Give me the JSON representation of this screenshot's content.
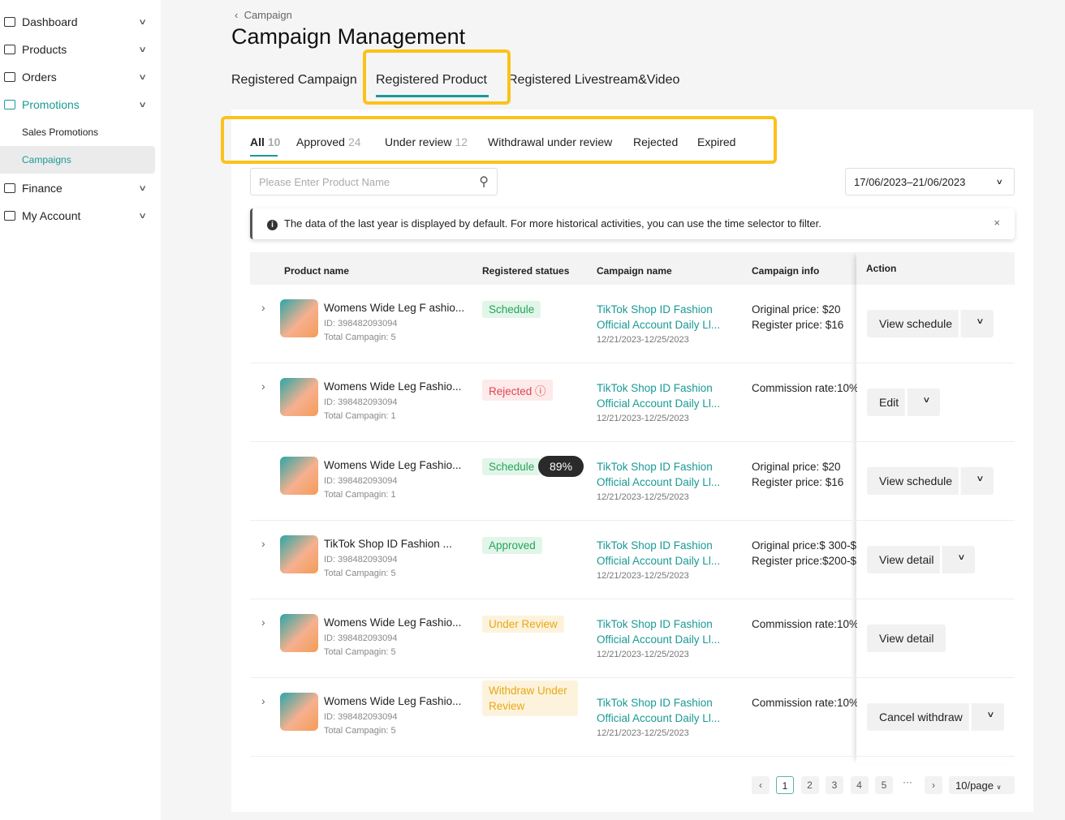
{
  "sidebar": {
    "items": [
      {
        "label": "Dashboard",
        "icon": "dashboard-icon"
      },
      {
        "label": "Products",
        "icon": "products-icon"
      },
      {
        "label": "Orders",
        "icon": "orders-icon"
      },
      {
        "label": "Promotions",
        "icon": "megaphone-icon"
      },
      {
        "label": "Sales Promotions"
      },
      {
        "label": "Campaigns"
      },
      {
        "label": "Finance",
        "icon": "finance-icon"
      },
      {
        "label": "My Account",
        "icon": "user-icon"
      }
    ]
  },
  "breadcrumb": "Campaign",
  "title": "Campaign Management",
  "tabs": [
    "Registered Campaign",
    "Registered Product",
    "Registered Livestream&Video"
  ],
  "status_tabs": [
    {
      "label": "All",
      "count": "10"
    },
    {
      "label": "Approved",
      "count": "24"
    },
    {
      "label": "Under review",
      "count": "12"
    },
    {
      "label": "Withdrawal under review"
    },
    {
      "label": "Rejected"
    },
    {
      "label": "Expired"
    }
  ],
  "search_placeholder": "Please Enter Product Name",
  "date_range": "17/06/2023–21/06/2023",
  "alert": "The data of the last year is displayed by default. For more historical activities, you can use the time selector to filter.",
  "columns": [
    "Product name",
    "Registered statues",
    "Campaign name",
    "Campaign info",
    "Action"
  ],
  "rows": [
    {
      "name": "Womens Wide Leg F ashio...",
      "id": "ID: 398482093094",
      "total": "Total Campagin: 5",
      "status": "Schedule",
      "tone": "green",
      "campaign": "TikTok Shop ID Fashion Official Account Daily Ll...",
      "dates": "12/21/2023-12/25/2023",
      "info": [
        "Original price:  $20",
        "Register price: $16"
      ],
      "action": "View schedule",
      "dropdown": true,
      "expand": true
    },
    {
      "name": "Womens Wide Leg Fashio...",
      "id": "ID: 398482093094",
      "total": "Total Campagin: 1",
      "status": "Rejected ⓘ",
      "tone": "red",
      "campaign": "TikTok Shop ID Fashion Official Account Daily Ll...",
      "dates": "12/21/2023-12/25/2023",
      "info": [
        "Commission rate:10%"
      ],
      "action": "Edit",
      "dropdown": true,
      "expand": true
    },
    {
      "name": "Womens Wide Leg Fashio...",
      "id": "ID: 398482093094",
      "total": "Total Campagin: 1",
      "status": "Schedule",
      "tone": "green",
      "progress": "89%",
      "campaign": "TikTok Shop ID Fashion Official Account Daily Ll...",
      "dates": "12/21/2023-12/25/2023",
      "info": [
        "Original price:  $20",
        "Register price: $16"
      ],
      "action": "View schedule",
      "dropdown": true,
      "expand": false
    },
    {
      "name": "TikTok Shop ID Fashion ...",
      "id": "ID: 398482093094",
      "total": "Total Campagin: 5",
      "status": "Approved",
      "tone": "green",
      "campaign": "TikTok Shop ID Fashion Official Account Daily Ll...",
      "dates": "12/21/2023-12/25/2023",
      "info": [
        "Original price:$ 300-$",
        "Register price:$200-$"
      ],
      "action": "View detail",
      "dropdown": true,
      "expand": true
    },
    {
      "name": "Womens Wide Leg Fashio...",
      "id": "ID: 398482093094",
      "total": "Total Campagin: 5",
      "status": "Under Review",
      "tone": "yellow",
      "campaign": "TikTok Shop ID Fashion Official Account Daily Ll...",
      "dates": "12/21/2023-12/25/2023",
      "info": [
        "Commission rate:10%"
      ],
      "action": "View detail",
      "dropdown": false,
      "expand": true
    },
    {
      "name": "Womens Wide Leg Fashio...",
      "id": "ID: 398482093094",
      "total": "Total Campagin: 5",
      "status": "Withdraw Under Review",
      "tone": "yellow",
      "campaign": "TikTok Shop ID Fashion Official Account Daily Ll...",
      "dates": "12/21/2023-12/25/2023",
      "info": [
        "Commission rate:10%"
      ],
      "action": "Cancel withdraw",
      "dropdown": true,
      "expand": true
    }
  ],
  "pagination": {
    "pages": [
      "1",
      "2",
      "3",
      "4",
      "5"
    ],
    "current": "1",
    "ellipsis": "···",
    "page_size": "10/page"
  },
  "colors": {
    "accent": "#1a9a95",
    "highlight": "#fbc21a"
  }
}
